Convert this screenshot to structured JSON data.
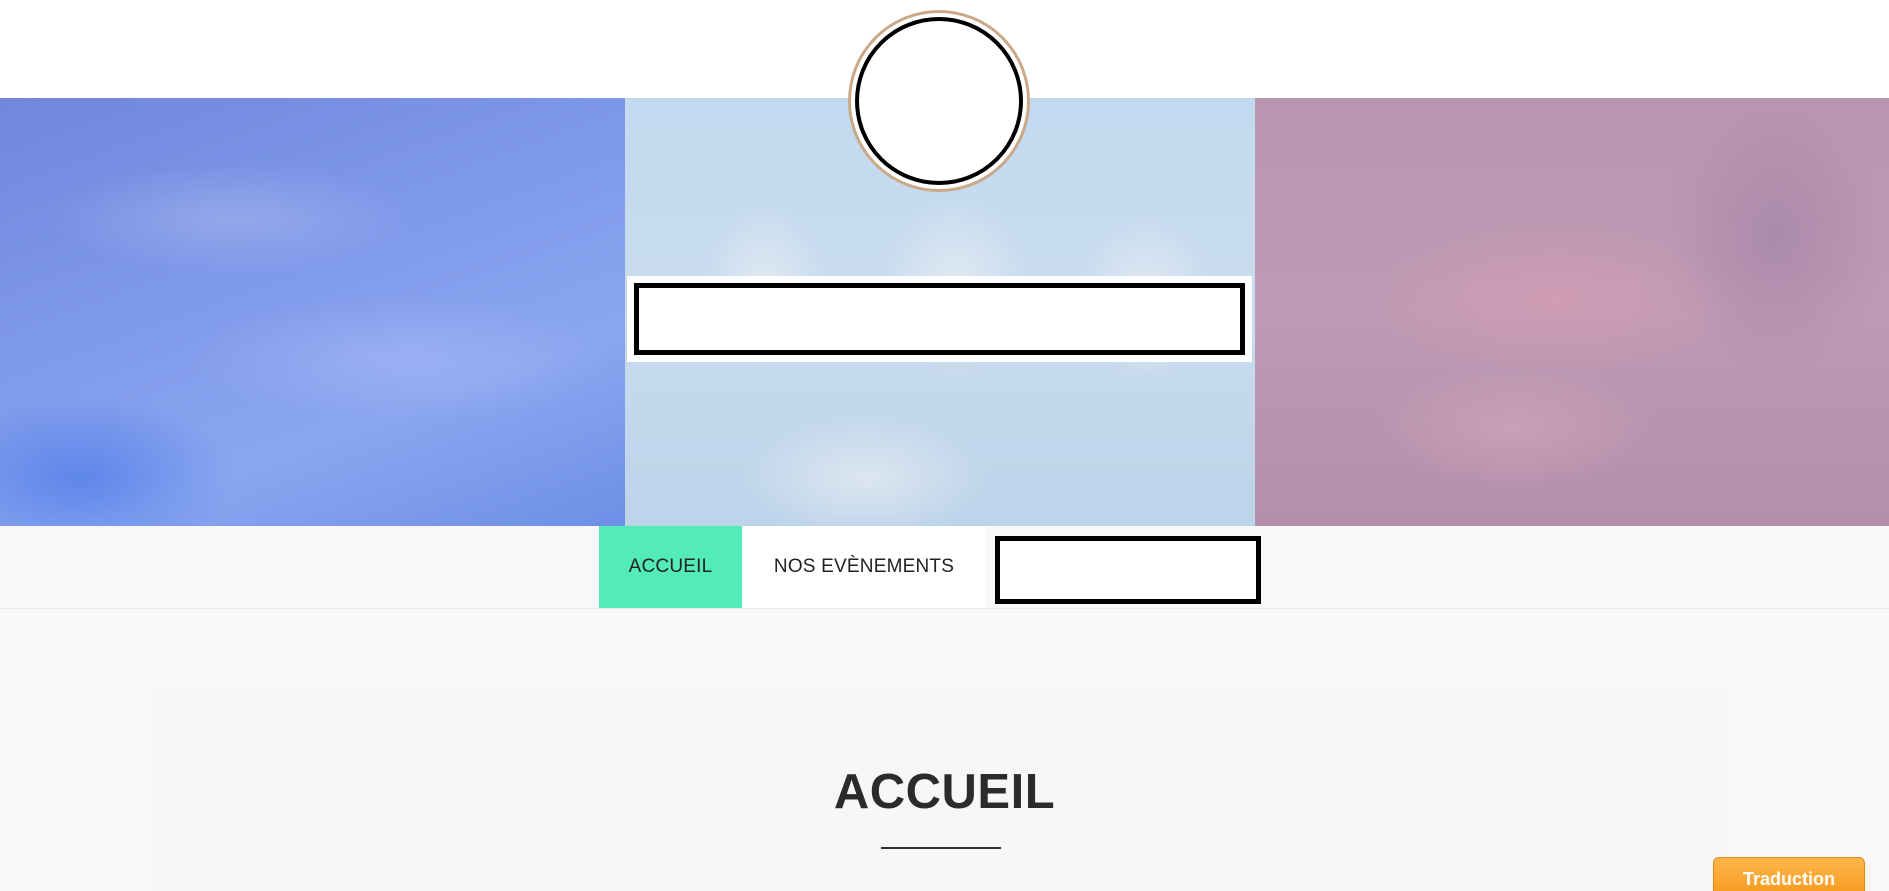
{
  "nav": {
    "items": [
      {
        "label": "ACCUEIL",
        "active": true
      },
      {
        "label": "NOS EVÈNEMENTS",
        "active": false
      }
    ]
  },
  "main": {
    "title": "ACCUEIL"
  },
  "translate": {
    "label": "Traduction"
  },
  "colors": {
    "nav_active": "#54ecb6",
    "translate_button": "#f7a42b",
    "hero_left": "#7f99ea",
    "hero_center": "#c2d9ef",
    "hero_right": "#b896b0"
  }
}
